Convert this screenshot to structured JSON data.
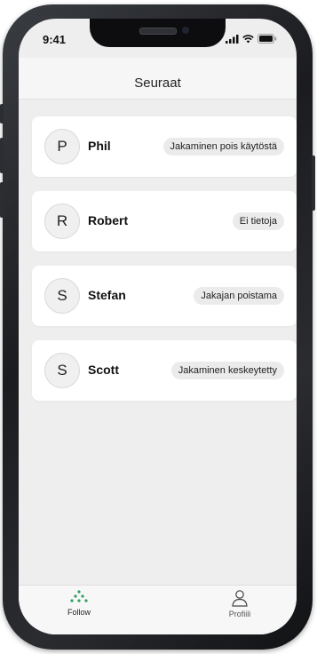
{
  "status_bar": {
    "time": "9:41"
  },
  "header": {
    "title": "Seuraat"
  },
  "follow_list": [
    {
      "initial": "P",
      "name": "Phil",
      "status": "Jakaminen pois käytöstä"
    },
    {
      "initial": "R",
      "name": "Robert",
      "status": "Ei tietoja"
    },
    {
      "initial": "S",
      "name": "Stefan",
      "status": "Jakajan poistama"
    },
    {
      "initial": "S",
      "name": "Scott",
      "status": "Jakaminen keskeytetty"
    }
  ],
  "tab_bar": {
    "tabs": [
      {
        "label": "Follow",
        "icon": "follow-dots-icon",
        "active": true
      },
      {
        "label": "Profiili",
        "icon": "person-icon",
        "active": false
      }
    ]
  },
  "colors": {
    "screen_background": "#efeeef",
    "card_background": "#ffffff",
    "badge_background": "#ecebec",
    "accent_green": "#2e9e5b"
  }
}
